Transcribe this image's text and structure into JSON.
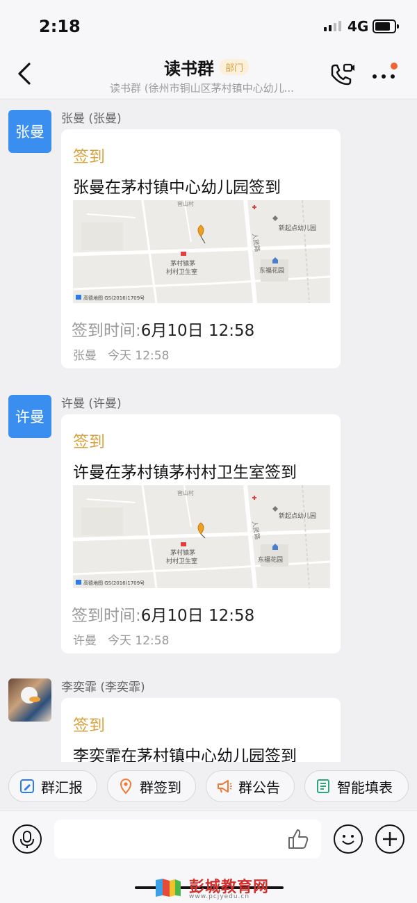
{
  "status_bar": {
    "time": "2:18",
    "network": "4G"
  },
  "header": {
    "title": "读书群",
    "badge": "部门",
    "subtitle": "读书群 (徐州市铜山区茅村镇中心幼儿..."
  },
  "messages": [
    {
      "avatar_text": "张曼",
      "sender": "张曼 (张曼)",
      "tag": "签到",
      "text": "张曼在茅村镇中心幼儿园签到",
      "time_label": "签到时间:",
      "time_value": "6月10日 12:58",
      "footer_name": "张曼",
      "footer_time": "今天 12:58",
      "map": {
        "label_clinic_1": "茅村镇茅",
        "label_clinic_2": "村村卫生室",
        "label_kindergarten": "新起点幼儿园",
        "label_garden": "东福花园",
        "label_road": "人民路",
        "label_village": "窖山村",
        "copyright": "高德地图 GS(2016)1709号"
      }
    },
    {
      "avatar_text": "许曼",
      "sender": "许曼 (许曼)",
      "tag": "签到",
      "text": "许曼在茅村镇茅村村卫生室签到",
      "time_label": "签到时间:",
      "time_value": "6月10日 12:58",
      "footer_name": "许曼",
      "footer_time": "今天 12:58",
      "map": {
        "label_clinic_1": "茅村镇茅",
        "label_clinic_2": "村村卫生室",
        "label_kindergarten": "新起点幼儿园",
        "label_garden": "东福花园",
        "label_road": "人民路",
        "label_village": "窖山村",
        "copyright": "高德地图 GS(2016)1709号"
      }
    },
    {
      "sender": "李奕霏 (李奕霏)",
      "tag": "签到",
      "text": "李奕霏在茅村镇中心幼儿园签到"
    }
  ],
  "actions": [
    {
      "label": "群汇报",
      "icon": "report-icon"
    },
    {
      "label": "群签到",
      "icon": "location-icon"
    },
    {
      "label": "群公告",
      "icon": "megaphone-icon"
    },
    {
      "label": "智能填表",
      "icon": "form-icon"
    }
  ],
  "watermark": {
    "text": "彭城教育网",
    "url": "www.pcjyedu.cn"
  },
  "colors": {
    "accent": "#d9a23c",
    "avatar_blue": "#3a8ef0",
    "action_orange": "#f07a34",
    "form_green": "#2aa876",
    "report_blue": "#2a7bf0"
  }
}
